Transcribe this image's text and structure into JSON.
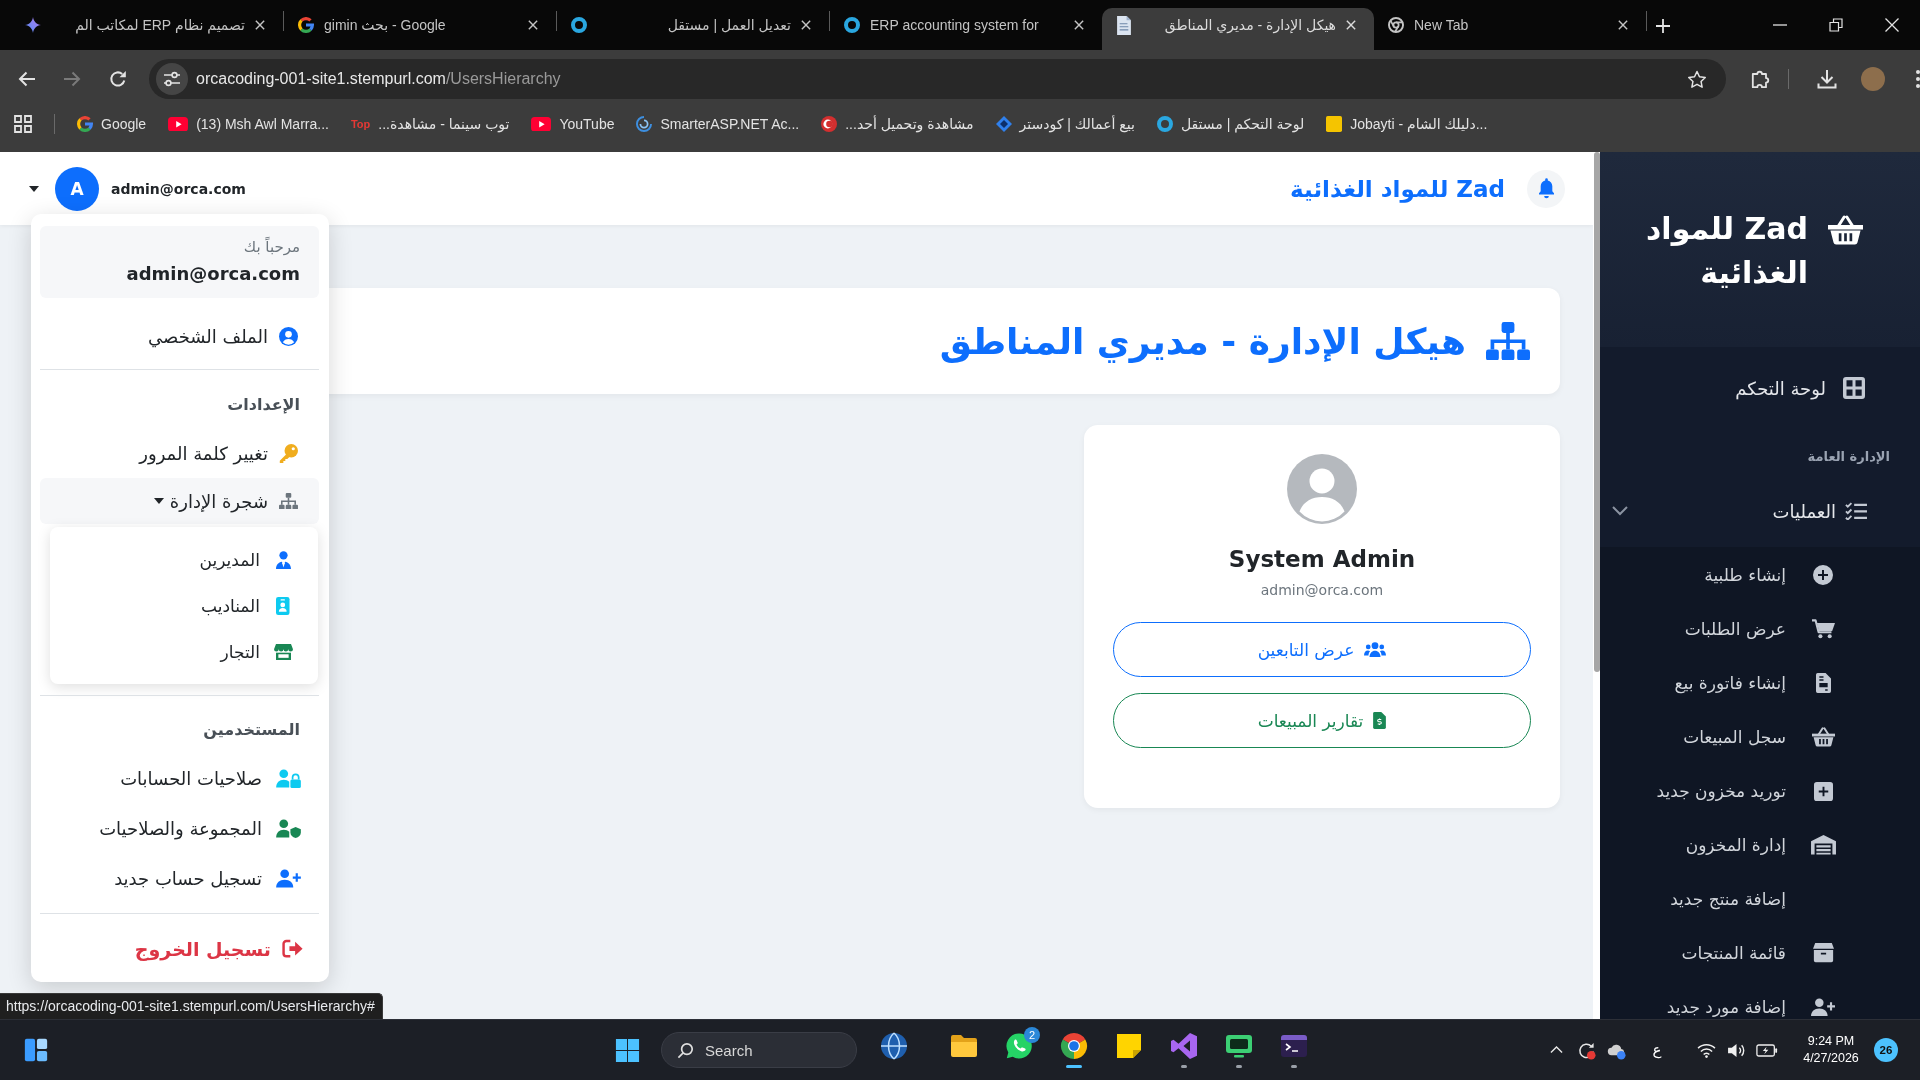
{
  "browser": {
    "tabs": [
      {
        "title": "New Tab",
        "selected": false
      },
      {
        "title": "هيكل الإدارة - مديري المناطق",
        "selected": true
      },
      {
        "title": "ERP accounting system for",
        "selected": false
      },
      {
        "title": "تعديل العمل | مستقل",
        "selected": false
      },
      {
        "title": "gimin بحث - Google",
        "selected": false
      },
      {
        "title": "تصميم نظام ERP لمكاتب الم",
        "selected": false
      }
    ],
    "nav_buttons": [
      {
        "disabled": false
      },
      {
        "disabled": true
      }
    ],
    "address": {
      "host": "orcacoding-001-site1.stempurl.com",
      "path": "/UsersHierarchy"
    },
    "bookmarks": [
      {
        "title": "Jobayti - دليلك الشام..."
      },
      {
        "title": "لوحة التحكم | مستقل"
      },
      {
        "title": "بيع أعمالك | كودستر"
      },
      {
        "title": "مشاهدة وتحميل أحد..."
      },
      {
        "title": "SmarterASP.NET Ac..."
      },
      {
        "title": "YouTube"
      },
      {
        "title": "توب سينما - مشاهدة...",
        "favicon_text": "Top"
      },
      {
        "title": "(13) Msh Awl Marra..."
      },
      {
        "title": "Google"
      }
    ]
  },
  "navbar": {
    "user": {
      "avatar_letter": "A",
      "email": "admin@orca.com"
    },
    "brand": "Zad للمواد الغذائية"
  },
  "user_menu": {
    "open": true,
    "greeting": "مرحباً بك",
    "email": "admin@orca.com",
    "profile": "الملف الشخصي",
    "settings_heading": "الإعدادات",
    "change_password": "تغيير كلمة المرور",
    "tree": {
      "label": "شجرة الإدارة",
      "expanded": true,
      "children": [
        "المديرين",
        "المناديب",
        "التجار"
      ]
    },
    "users_heading": "المستخدمين",
    "users_items": [
      "صلاحيات الحسابات",
      "المجموعة والصلاحيات",
      "تسجيل حساب جديد"
    ],
    "logout": "تسجيل الخروج"
  },
  "page_header": {
    "title": "هيكل الإدارة - مديري المناطق"
  },
  "profile_card": {
    "name": "System Admin",
    "email": "admin@orca.com",
    "buttons": [
      {
        "label": "عرض التابعين",
        "kind": "primary"
      },
      {
        "label": "تقارير المبيعات",
        "kind": "success"
      }
    ]
  },
  "sidebar": {
    "brand": "Zad للمواد الغذائية",
    "dashboard": "لوحة التحكم",
    "section_heading": "الإدارة العامة",
    "groups": [
      {
        "label": "العمليات",
        "expanded": true,
        "children": [
          "إنشاء طلبية",
          "عرض الطلبات",
          "إنشاء فاتورة بيع",
          "سجل المبيعات",
          "توريد مخزون جديد",
          "إدارة المخزون",
          "إضافة منتج جديد",
          "قائمة المنتجات",
          "إضافة مورد جديد"
        ]
      }
    ]
  },
  "link_preview": "https://orcacoding-001-site1.stempurl.com/UsersHierarchy#",
  "taskbar": {
    "search": {
      "placeholder": "Search"
    },
    "apps": [
      {
        "open": false,
        "selected": false
      },
      {
        "open": false,
        "selected": false
      },
      {
        "open": false,
        "selected": false,
        "badge": "2"
      },
      {
        "open": true,
        "selected": true
      },
      {
        "open": false,
        "selected": false
      },
      {
        "open": true,
        "selected": false
      },
      {
        "open": true,
        "selected": false
      },
      {
        "open": true,
        "selected": false
      }
    ],
    "input_language": "ع",
    "time": "9:24 PM",
    "date": "4/27/2026",
    "notification_count": "26"
  }
}
